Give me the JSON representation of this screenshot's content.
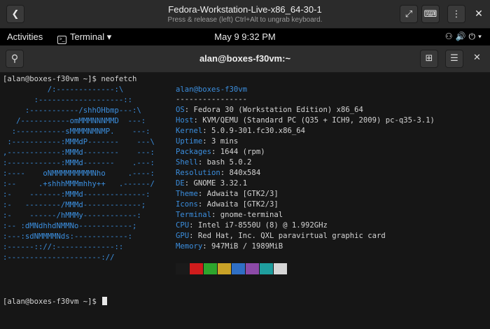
{
  "boxes": {
    "title": "Fedora-Workstation-Live-x86_64-30-1",
    "subtitle": "Press & release (left) Ctrl+Alt to ungrab keyboard."
  },
  "gnome": {
    "activities": "Activities",
    "app_menu": "Terminal ▾",
    "clock": "May 9   9:32 PM"
  },
  "terminal": {
    "title": "alan@boxes-f30vm:~",
    "prompt": "[alan@boxes-f30vm ~]$ ",
    "command": "neofetch",
    "logo": [
      "          /:-------------:\\",
      "       :-------------------::",
      "     :-----------/shhOHbmp---:\\",
      "   /-----------omMMMNNNMMD  ---:",
      "  :-----------sMMMMNMNMP.    ---:",
      " :-----------:MMMdP-------    ---\\",
      ",------------:MMMd--------    ---:",
      ":------------:MMMd-------    .---:",
      ":----    oNMMMMMMMMMNho     .----:",
      ":--     .+shhhMMMmhhy++   .------/",
      ":-    -------:MMMd--------------:",
      ":-   --------/MMMd-------------;",
      ":-    ------/hMMMy------------:",
      ":-- :dMNdhhdNMMNo------------;",
      ":---:sdNMMMMNds:------------:",
      ":------:://:-------------::",
      ":---------------------://"
    ],
    "user_host": "alan@boxes-f30vm",
    "separator": "----------------",
    "info": [
      {
        "key": "OS",
        "value": "Fedora 30 (Workstation Edition) x86_64"
      },
      {
        "key": "Host",
        "value": "KVM/QEMU (Standard PC (Q35 + ICH9, 2009) pc-q35-3.1)"
      },
      {
        "key": "Kernel",
        "value": "5.0.9-301.fc30.x86_64"
      },
      {
        "key": "Uptime",
        "value": "3 mins"
      },
      {
        "key": "Packages",
        "value": "1644 (rpm)"
      },
      {
        "key": "Shell",
        "value": "bash 5.0.2"
      },
      {
        "key": "Resolution",
        "value": "840x584"
      },
      {
        "key": "DE",
        "value": "GNOME 3.32.1"
      },
      {
        "key": "Theme",
        "value": "Adwaita [GTK2/3]"
      },
      {
        "key": "Icons",
        "value": "Adwaita [GTK2/3]"
      },
      {
        "key": "Terminal",
        "value": "gnome-terminal"
      },
      {
        "key": "CPU",
        "value": "Intel i7-8550U (8) @ 1.992GHz"
      },
      {
        "key": "GPU",
        "value": "Red Hat, Inc. QXL paravirtual graphic card"
      },
      {
        "key": "Memory",
        "value": "947MiB / 1989MiB"
      }
    ],
    "palette": [
      "#1a1a1a",
      "#d01c1c",
      "#2da52d",
      "#c9a227",
      "#2f6fc4",
      "#8c4aa7",
      "#1f9e9e",
      "#d6d6d6"
    ]
  }
}
